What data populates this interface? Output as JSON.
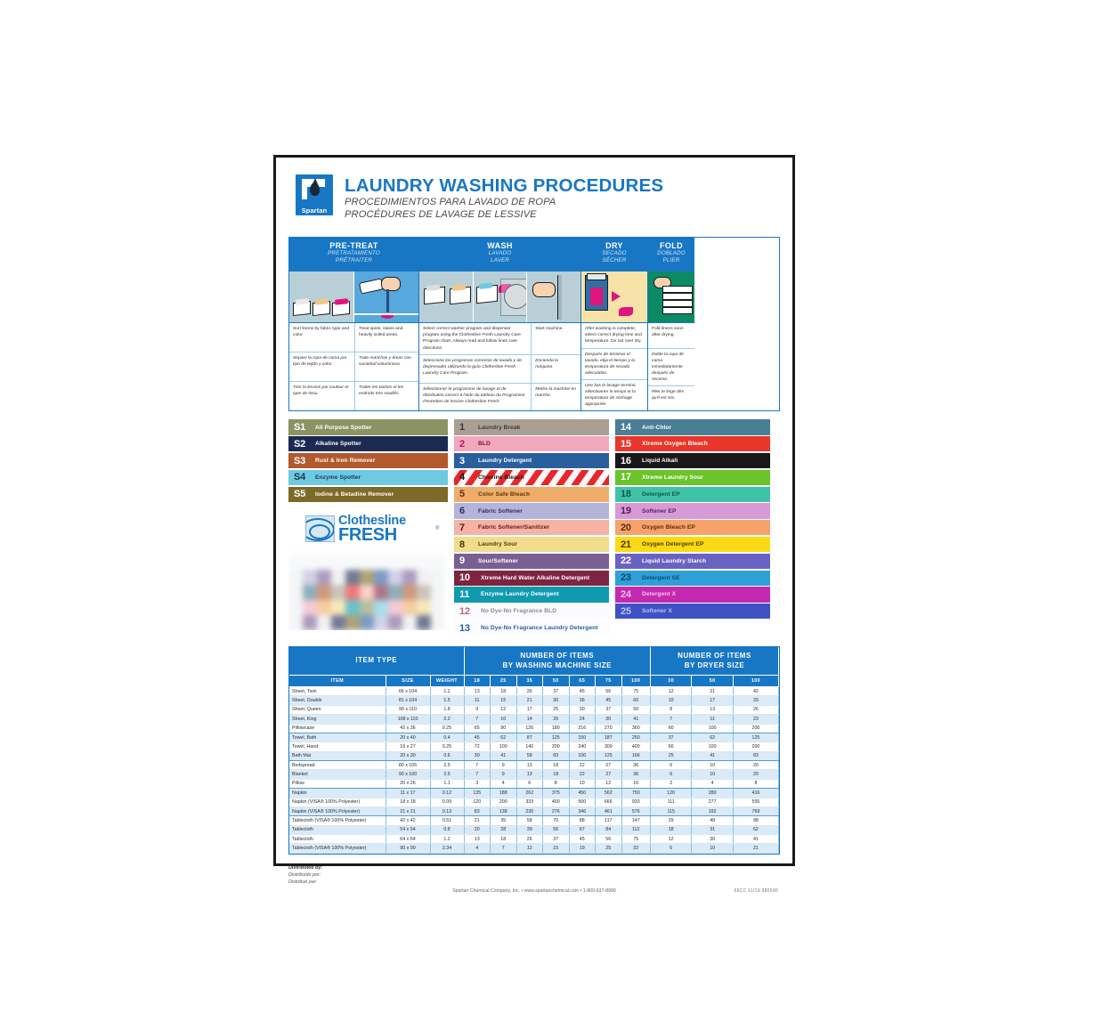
{
  "header": {
    "title": "LAUNDRY WASHING PROCEDURES",
    "subtitle_es": "PROCEDIMIENTOS PARA LAVADO DE ROPA",
    "subtitle_fr": "PROCÉDURES DE LAVAGE DE LESSIVE",
    "logo_name": "Spartan",
    "brand_color": "#1877c4"
  },
  "process": {
    "columns": [
      {
        "en": "PRE-TREAT",
        "es": "PRETRATAMIENTO",
        "fr": "PRÉTRAITER"
      },
      {
        "en": "WASH",
        "es": "LAVADO",
        "fr": "LAVER"
      },
      {
        "en": "DRY",
        "es": "SECADO",
        "fr": "SÉCHER"
      },
      {
        "en": "FOLD",
        "es": "DOBLADO",
        "fr": "PLIER"
      }
    ],
    "steps": [
      {
        "en": "Sort linens by fabric type and color.",
        "es": "Separe la ropa de cama por tipo de tejido y color.",
        "fr": "Trier la lessive par couleur et type de tissu."
      },
      {
        "en": "Treat spots, stains and heavily soiled areas.",
        "es": "Trate manchas y áreas con suciedad voluminosa.",
        "fr": "Traiter les taches et les endroits très souillés."
      },
      {
        "en": "Select correct washer program and dispenser program using the Clothesline Fresh Laundry Care Program chart. Always read and follow linen care directions.",
        "es": "Seleccione los programas correctos de lavado y de dispensador utilizando la guía Clothesline Fresh Laundry Care Program.",
        "fr": "Sélectionner le programme de lavage et de distribution correct à l'aide du tableau du Programme d'entretien de lessive Clothesline Fresh."
      },
      {
        "en": "Start machine.",
        "es": "Encienda la máquina.",
        "fr": "Mettre la machine en marche."
      },
      {
        "en": "After washing is complete, select correct drying time and temperature. Do not over dry.",
        "es": "Después de terminar el lavado, elija el tiempo y la temperatura de secado adecuadas.",
        "fr": "Une fois le lavage terminé, sélectionner le temps et la température de séchage appropriée."
      },
      {
        "en": "Fold linens soon after drying.",
        "es": "Doble la ropa de cama inmediatamente después de secarse.",
        "fr": "Plier le linge dès qu'il est sec."
      }
    ]
  },
  "legend": {
    "spotters": [
      {
        "code": "S1",
        "label": "All Purpose Spotter",
        "bg": "#8a9463",
        "fg": "#ffffff"
      },
      {
        "code": "S2",
        "label": "Alkaline Spotter",
        "bg": "#1c2a52",
        "fg": "#ffffff"
      },
      {
        "code": "S3",
        "label": "Rust & Iron Remover",
        "bg": "#b25a2e",
        "fg": "#ffffff"
      },
      {
        "code": "S4",
        "label": "Enzyme Spotter",
        "bg": "#6fc9e0",
        "fg": "#1b3b52"
      },
      {
        "code": "S5",
        "label": "Iodine & Betadine Remover",
        "bg": "#7d6a28",
        "fg": "#ffffff"
      }
    ],
    "middle": [
      {
        "code": "1",
        "label": "Laundry Break",
        "bg": "#a9a093",
        "fg": "#3a3a3a"
      },
      {
        "code": "2",
        "label": "BLD",
        "bg": "#f0a8bc",
        "fg": "#7d1437",
        "numfg": "#b0185a"
      },
      {
        "code": "3",
        "label": "Laundry Detergent",
        "bg": "#2a5f9e",
        "fg": "#ffffff"
      },
      {
        "code": "4",
        "label": "Chlorine Bleach",
        "bg": "#e8262a",
        "fg": "#1a1a1a",
        "striped": true
      },
      {
        "code": "5",
        "label": "Color Safe Bleach",
        "bg": "#f0ad6a",
        "fg": "#5a3410"
      },
      {
        "code": "6",
        "label": "Fabric Softener",
        "bg": "#b4b4d8",
        "fg": "#2d2d63"
      },
      {
        "code": "7",
        "label": "Fabric Softener/Sanitizer",
        "bg": "#f4b3a6",
        "fg": "#5a1f12"
      },
      {
        "code": "8",
        "label": "Laundry Sour",
        "bg": "#f0dc8c",
        "fg": "#4a3a0a"
      },
      {
        "code": "9",
        "label": "Sour/Softener",
        "bg": "#7a5f94",
        "fg": "#ffffff"
      },
      {
        "code": "10",
        "label": "Xtreme Hard Water Alkaline Detergent",
        "bg": "#7e2440",
        "fg": "#ffffff"
      },
      {
        "code": "11",
        "label": "Enzyme Laundry Detergent",
        "bg": "#0f9aad",
        "fg": "#ffffff"
      },
      {
        "code": "12",
        "label": "No Dye-No Fragrance BLD",
        "bg": "#fbfbfd",
        "fg": "#8a8a96",
        "numfg": "#b06a8a"
      },
      {
        "code": "13",
        "label": "No Dye-No Fragrance Laundry Detergent",
        "bg": "#fafcfe",
        "fg": "#2a5f9e",
        "numfg": "#2a5f9e"
      }
    ],
    "right": [
      {
        "code": "14",
        "label": "Anti-Chlor",
        "bg": "#4a7e94",
        "fg": "#ffffff"
      },
      {
        "code": "15",
        "label": "Xtreme Oxygen Bleach",
        "bg": "#e8372a",
        "fg": "#ffffff"
      },
      {
        "code": "16",
        "label": "Liquid Alkali",
        "bg": "#18181a",
        "fg": "#ffffff"
      },
      {
        "code": "17",
        "label": "Xtreme Laundry Sour",
        "bg": "#6ac42a",
        "fg": "#ffffff"
      },
      {
        "code": "18",
        "label": "Detergent EP",
        "bg": "#3fc3a8",
        "fg": "#15564a"
      },
      {
        "code": "19",
        "label": "Softener EP",
        "bg": "#d79ad8",
        "fg": "#53215a"
      },
      {
        "code": "20",
        "label": "Oxygen Bleach EP",
        "bg": "#f7a26a",
        "fg": "#5a2c0a"
      },
      {
        "code": "21",
        "label": "Oxygen Detergent EP",
        "bg": "#fbd915",
        "fg": "#4a3a00"
      },
      {
        "code": "22",
        "label": "Liquid Laundry Starch",
        "bg": "#6a62c2",
        "fg": "#ffffff"
      },
      {
        "code": "23",
        "label": "Detergent SE",
        "bg": "#2f9fd6",
        "fg": "#0e4a6e"
      },
      {
        "code": "24",
        "label": "Detergent X",
        "bg": "#c42ab0",
        "fg": "#f7c2ea"
      },
      {
        "code": "25",
        "label": "Softener X",
        "bg": "#3f52c4",
        "fg": "#b8c4f0"
      }
    ],
    "brand": {
      "line1": "Clothesline",
      "line2": "FRESH",
      "registered": "®"
    }
  },
  "table": {
    "group_headers": {
      "item_type": "ITEM TYPE",
      "washer": "NUMBER OF ITEMS\nBY WASHING MACHINE SIZE",
      "washer_l1": "NUMBER OF ITEMS",
      "washer_l2": "BY WASHING MACHINE SIZE",
      "dryer_l1": "NUMBER OF ITEMS",
      "dryer_l2": "BY DRYER SIZE"
    },
    "columns": [
      "ITEM",
      "SIZE",
      "WEIGHT",
      "18",
      "25",
      "35",
      "50",
      "65",
      "75",
      "100",
      "30",
      "50",
      "100"
    ],
    "rows": [
      {
        "item": "Sheet, Twin",
        "size": "66 x 104",
        "weight": "1.2",
        "w": [
          "13",
          "18",
          "26",
          "37",
          "45",
          "56",
          "75"
        ],
        "d": [
          "12",
          "21",
          "42"
        ]
      },
      {
        "item": "Sheet, Double",
        "size": "81 x 104",
        "weight": "1.5",
        "w": [
          "11",
          "15",
          "21",
          "30",
          "36",
          "45",
          "60"
        ],
        "d": [
          "10",
          "17",
          "33"
        ]
      },
      {
        "item": "Sheet, Queen",
        "size": "90 x 110",
        "weight": "1.8",
        "w": [
          "9",
          "12",
          "17",
          "25",
          "30",
          "37",
          "50"
        ],
        "d": [
          "8",
          "13",
          "26"
        ]
      },
      {
        "item": "Sheet, King",
        "size": "108 x 110",
        "weight": "2.2",
        "w": [
          "7",
          "10",
          "14",
          "20",
          "24",
          "30",
          "41"
        ],
        "d": [
          "7",
          "11",
          "23"
        ]
      },
      {
        "item": "Pillowcase",
        "size": "42 x 36",
        "weight": "0.25",
        "w": [
          "65",
          "90",
          "126",
          "180",
          "216",
          "270",
          "360"
        ],
        "d": [
          "60",
          "100",
          "200"
        ],
        "group_end": true
      },
      {
        "item": "Towel, Bath",
        "size": "20 x 40",
        "weight": "0.4",
        "w": [
          "45",
          "62",
          "87",
          "125",
          "150",
          "187",
          "250"
        ],
        "d": [
          "37",
          "62",
          "125"
        ]
      },
      {
        "item": "Towel, Hand",
        "size": "16 x 27",
        "weight": "0.25",
        "w": [
          "72",
          "100",
          "140",
          "200",
          "240",
          "300",
          "400"
        ],
        "d": [
          "60",
          "100",
          "200"
        ]
      },
      {
        "item": "Bath Mat",
        "size": "20 x 30",
        "weight": "0.6",
        "w": [
          "30",
          "41",
          "58",
          "83",
          "100",
          "125",
          "166"
        ],
        "d": [
          "25",
          "41",
          "83"
        ],
        "group_end": true
      },
      {
        "item": "Bedspread",
        "size": "80 x 105",
        "weight": "2.5",
        "w": [
          "7",
          "9",
          "13",
          "18",
          "22",
          "27",
          "36"
        ],
        "d": [
          "6",
          "10",
          "20"
        ]
      },
      {
        "item": "Blanket",
        "size": "90 x 100",
        "weight": "2.5",
        "w": [
          "7",
          "9",
          "13",
          "18",
          "22",
          "27",
          "36"
        ],
        "d": [
          "6",
          "10",
          "20"
        ]
      },
      {
        "item": "Pillow",
        "size": "20 x 26",
        "weight": "1.1",
        "w": [
          "3",
          "4",
          "6",
          "8",
          "10",
          "12",
          "16"
        ],
        "d": [
          "2",
          "4",
          "8"
        ],
        "group_end": true
      },
      {
        "item": "Napkin",
        "size": "11 x 17",
        "weight": "0.12",
        "w": [
          "135",
          "188",
          "262",
          "375",
          "450",
          "562",
          "750"
        ],
        "d": [
          "120",
          "280",
          "416"
        ]
      },
      {
        "item": "Napkin (VISA® 100% Polyester)",
        "size": "18 x 18",
        "weight": "0.09",
        "w": [
          "120",
          "200",
          "333",
          "400",
          "500",
          "666",
          "933"
        ],
        "d": [
          "111",
          "277",
          "555"
        ]
      },
      {
        "item": "Napkin (VISA® 100% Polyester)",
        "size": "21 x 21",
        "weight": "0.13",
        "w": [
          "83",
          "138",
          "230",
          "276",
          "346",
          "461",
          "576"
        ],
        "d": [
          "115",
          "192",
          "769"
        ],
        "group_end": true
      },
      {
        "item": "Tablecloth (VISA® 100% Polyester)",
        "size": "42 x 42",
        "weight": "0.51",
        "w": [
          "21",
          "35",
          "58",
          "70",
          "88",
          "117",
          "147"
        ],
        "d": [
          "29",
          "49",
          "98"
        ]
      },
      {
        "item": "Tablecloth",
        "size": "54 x 54",
        "weight": "0.8",
        "w": [
          "20",
          "28",
          "39",
          "56",
          "67",
          "84",
          "112"
        ],
        "d": [
          "18",
          "31",
          "62"
        ]
      },
      {
        "item": "Tablecloth",
        "size": "64 x 64",
        "weight": "1.2",
        "w": [
          "13",
          "18",
          "26",
          "37",
          "45",
          "56",
          "75"
        ],
        "d": [
          "12",
          "30",
          "41"
        ]
      },
      {
        "item": "Tablecloth (VISA® 100% Polyester)",
        "size": "90 x 90",
        "weight": "2.34",
        "w": [
          "4",
          "7",
          "12",
          "15",
          "19",
          "25",
          "32"
        ],
        "d": [
          "6",
          "10",
          "21"
        ]
      }
    ]
  },
  "footer": {
    "distributed_en": "Distributed by:",
    "distributed_es": "Distribuido por:",
    "distributed_fr": "Distribué par:",
    "company": "Spartan Chemical Company, Inc.  •  www.spartanchemical.com  •  1-800-537-8990",
    "code": "65CC  11/19  980500"
  }
}
